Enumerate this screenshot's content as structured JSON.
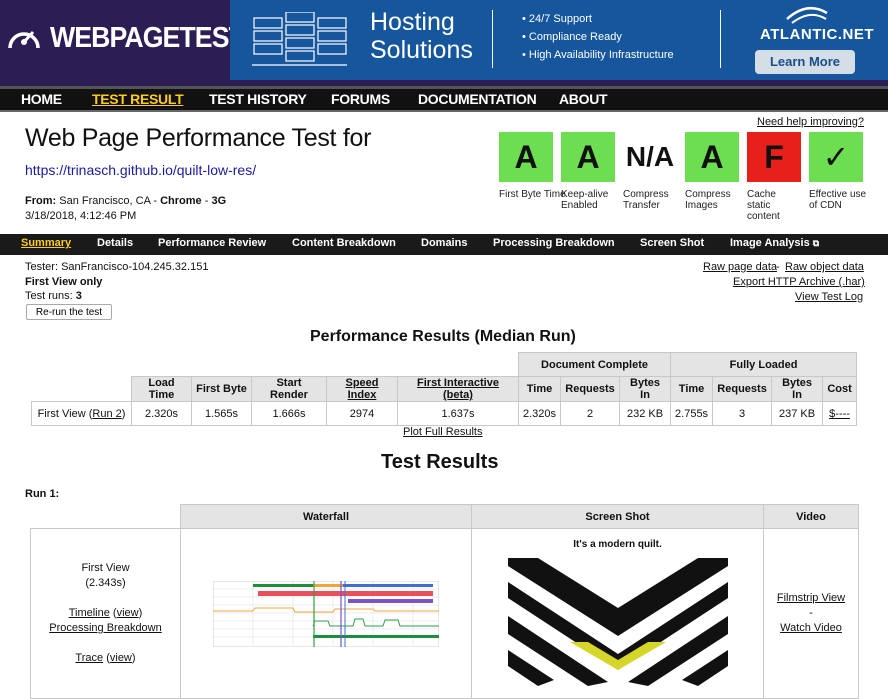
{
  "header": {
    "logo_text": "WEBPAGETEST"
  },
  "ad": {
    "title_line1": "Hosting",
    "title_line2": "Solutions",
    "bullets": [
      "24/7 Support",
      "Compliance Ready",
      "High Availability Infrastructure"
    ],
    "brand": "ATLANTIC.NET",
    "cta": "Learn More"
  },
  "nav": {
    "items": [
      "HOME",
      "TEST RESULT",
      "TEST HISTORY",
      "FORUMS",
      "DOCUMENTATION",
      "ABOUT"
    ],
    "active": "TEST RESULT"
  },
  "page": {
    "title": "Web Page Performance Test for",
    "url": "https://trinasch.github.io/quilt-low-res/",
    "from_label": "From:",
    "from_location": "San Francisco, CA - ",
    "browser": "Chrome",
    "connection_sep": " - ",
    "connection": "3G",
    "date": "3/18/2018, 4:12:46 PM",
    "help_link": "Need help improving?"
  },
  "grades": [
    {
      "grade": "A",
      "label": "First Byte Time",
      "color": "#6ddd52"
    },
    {
      "grade": "A",
      "label": "Keep-alive Enabled",
      "color": "#6ddd52"
    },
    {
      "grade": "N/A",
      "label": "Compress Transfer",
      "color": "#ffffff"
    },
    {
      "grade": "A",
      "label": "Compress Images",
      "color": "#6ddd52"
    },
    {
      "grade": "F",
      "label": "Cache static content",
      "color": "#e8201c"
    },
    {
      "grade": "✓",
      "label": "Effective use of CDN",
      "color": "#6ddd52"
    }
  ],
  "subnav": {
    "items": [
      "Summary",
      "Details",
      "Performance Review",
      "Content Breakdown",
      "Domains",
      "Processing Breakdown",
      "Screen Shot",
      "Image Analysis"
    ],
    "active": "Summary"
  },
  "info": {
    "tester": "Tester: SanFrancisco-104.245.32.151",
    "view": "First View only",
    "runs_label": "Test runs: ",
    "runs": "3",
    "rerun": "Re-run the test",
    "links": [
      "Raw page data",
      "Raw object data",
      "Export HTTP Archive (.har)",
      "View Test Log"
    ],
    "link_sep": " - "
  },
  "perf": {
    "title": "Performance Results (Median Run)",
    "group_doc": "Document Complete",
    "group_full": "Fully Loaded",
    "headers": [
      "Load Time",
      "First Byte",
      "Start Render",
      "Speed Index",
      "First Interactive (beta)",
      "Time",
      "Requests",
      "Bytes In",
      "Time",
      "Requests",
      "Bytes In",
      "Cost"
    ],
    "row_label": "First View (",
    "row_run": "Run 2",
    "row_close": ")",
    "values": [
      "2.320s",
      "1.565s",
      "1.666s",
      "2974",
      "1.637s",
      "2.320s",
      "2",
      "232 KB",
      "2.755s",
      "3",
      "237 KB",
      "$----"
    ],
    "plot_link": "Plot Full Results"
  },
  "results": {
    "title": "Test Results",
    "run_label": "Run 1:",
    "headers": [
      "Waterfall",
      "Screen Shot",
      "Video"
    ],
    "view": "First View",
    "time": "(2.343s)",
    "links": {
      "timeline": "Timeline",
      "view1": "view",
      "processing": "Processing Breakdown",
      "trace": "Trace",
      "view2": "view",
      "filmstrip": "Filmstrip View",
      "sep": "-",
      "watch": "Watch Video"
    },
    "screenshot_text": "It's a modern quilt."
  }
}
